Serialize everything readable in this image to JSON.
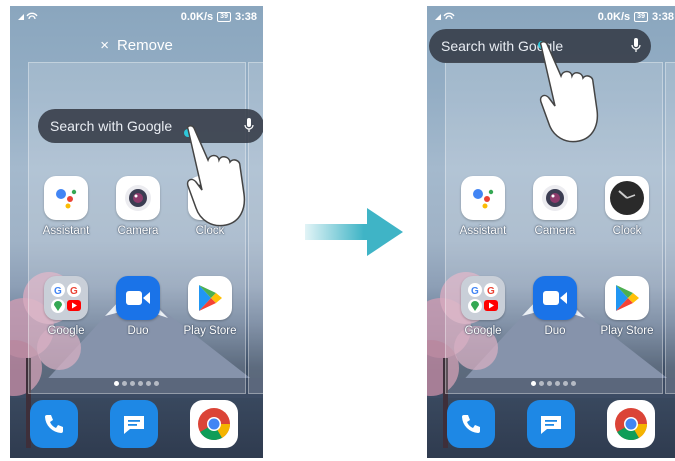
{
  "status_bar": {
    "speed": "0.0K/s",
    "battery": "39",
    "time": "3:38"
  },
  "remove_bar": {
    "close_glyph": "×",
    "label": "Remove"
  },
  "search": {
    "placeholder": "Search with Google"
  },
  "apps": [
    {
      "label": "Assistant",
      "icon": "assistant-icon"
    },
    {
      "label": "Camera",
      "icon": "camera-icon"
    },
    {
      "label": "Clock",
      "icon": "clock-icon"
    },
    {
      "label": "Google",
      "icon": "google-folder-icon"
    },
    {
      "label": "Duo",
      "icon": "duo-icon"
    },
    {
      "label": "Play Store",
      "icon": "play-store-icon"
    }
  ],
  "dock": [
    "phone-icon",
    "messages-icon",
    "chrome-icon"
  ],
  "transition": {
    "icon": "arrow-right-icon",
    "color": "#3fb4c6"
  },
  "accent_touch_color": "#2ec7d9"
}
